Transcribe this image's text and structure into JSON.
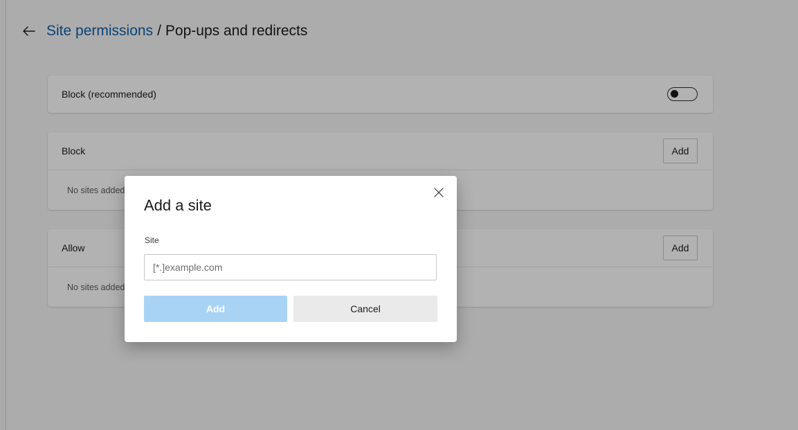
{
  "header": {
    "back_icon": "arrow-left-icon",
    "breadcrumb_link": "Site permissions",
    "separator": "/",
    "current_page": "Pop-ups and redirects"
  },
  "block_recommended": {
    "label": "Block (recommended)",
    "toggle_on": false
  },
  "block_section": {
    "title": "Block",
    "add_label": "Add",
    "empty_text": "No sites added"
  },
  "allow_section": {
    "title": "Allow",
    "add_label": "Add",
    "empty_text": "No sites added"
  },
  "dialog": {
    "title": "Add a site",
    "close_icon": "close-icon",
    "field_label": "Site",
    "input_value": "",
    "input_placeholder": "[*.]example.com",
    "add_label": "Add",
    "cancel_label": "Cancel"
  },
  "colors": {
    "link": "#0f5fa8",
    "primary_disabled": "#a9d3f5",
    "secondary_button": "#eaeaea",
    "overlay": "rgba(0,0,0,0.30)"
  }
}
